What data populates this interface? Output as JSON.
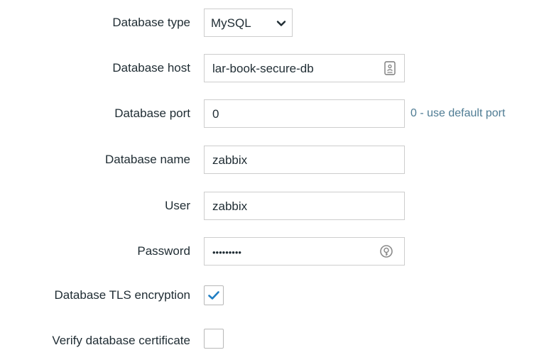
{
  "fields": {
    "db_type": {
      "label": "Database type",
      "value": "MySQL"
    },
    "db_host": {
      "label": "Database host",
      "value": "lar-book-secure-db"
    },
    "db_port": {
      "label": "Database port",
      "value": "0",
      "hint": "0 - use default port"
    },
    "db_name": {
      "label": "Database name",
      "value": "zabbix"
    },
    "user": {
      "label": "User",
      "value": "zabbix"
    },
    "password": {
      "label": "Password",
      "value": "•••••••••"
    },
    "tls": {
      "label": "Database TLS encryption",
      "checked": true
    },
    "verify_cert": {
      "label": "Verify database certificate",
      "checked": false
    }
  },
  "icons": {
    "select_arrow": "chevron-down-icon",
    "host_autofill": "contact-card-icon",
    "password_manager": "key-icon",
    "checkmark": "checkmark-icon"
  },
  "colors": {
    "accent": "#1f7ec3",
    "hint": "#4f7c94",
    "border": "#cdcdcd",
    "text": "#1f2c33"
  }
}
